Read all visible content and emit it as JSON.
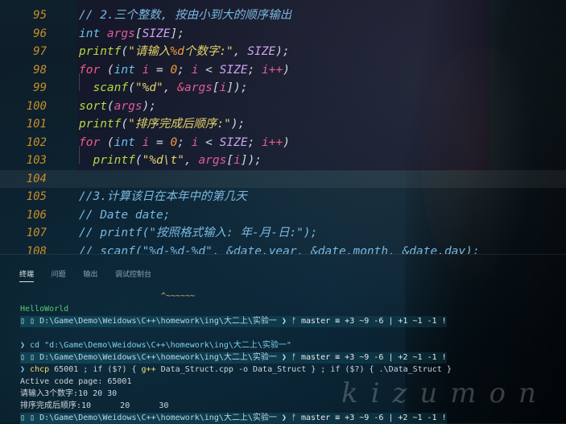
{
  "editor": {
    "lines": [
      {
        "n": "95",
        "tokens": [
          [
            "t-comment",
            "// 2.三个整数, 按由小到大的顺序输出"
          ]
        ]
      },
      {
        "n": "96",
        "tokens": [
          [
            "t-type",
            "int "
          ],
          [
            "t-var",
            "args"
          ],
          [
            "t-punc",
            "["
          ],
          [
            "t-const",
            "SIZE"
          ],
          [
            "t-punc",
            "];"
          ]
        ]
      },
      {
        "n": "97",
        "tokens": [
          [
            "t-fn",
            "printf"
          ],
          [
            "t-punc",
            "("
          ],
          [
            "t-str",
            "\"请输入"
          ],
          [
            "t-num",
            "%d"
          ],
          [
            "t-str",
            "个数字:\""
          ],
          [
            "t-punc",
            ", "
          ],
          [
            "t-const",
            "SIZE"
          ],
          [
            "t-punc",
            ");"
          ]
        ]
      },
      {
        "n": "98",
        "tokens": [
          [
            "t-kw",
            "for "
          ],
          [
            "t-punc",
            "("
          ],
          [
            "t-type",
            "int "
          ],
          [
            "t-var",
            "i"
          ],
          [
            "t-punc",
            " = "
          ],
          [
            "t-num",
            "0"
          ],
          [
            "t-punc",
            "; "
          ],
          [
            "t-var",
            "i"
          ],
          [
            "t-punc",
            " < "
          ],
          [
            "t-const",
            "SIZE"
          ],
          [
            "t-punc",
            "; "
          ],
          [
            "t-var",
            "i"
          ],
          [
            "t-kw",
            "++"
          ],
          [
            "t-punc",
            ")"
          ]
        ]
      },
      {
        "n": "99",
        "tokens": [
          [
            "t-ws",
            "  "
          ],
          [
            "t-fn",
            "scanf"
          ],
          [
            "t-punc",
            "("
          ],
          [
            "t-str",
            "\"%d\""
          ],
          [
            "t-punc",
            ", "
          ],
          [
            "t-kw",
            "&"
          ],
          [
            "t-var",
            "args"
          ],
          [
            "t-punc",
            "["
          ],
          [
            "t-var",
            "i"
          ],
          [
            "t-punc",
            "]);"
          ]
        ]
      },
      {
        "n": "100",
        "tokens": [
          [
            "t-fn",
            "sort"
          ],
          [
            "t-punc",
            "("
          ],
          [
            "t-var",
            "args"
          ],
          [
            "t-punc",
            ");"
          ]
        ]
      },
      {
        "n": "101",
        "tokens": [
          [
            "t-fn",
            "printf"
          ],
          [
            "t-punc",
            "("
          ],
          [
            "t-str",
            "\"排序完成后顺序:\""
          ],
          [
            "t-punc",
            ");"
          ]
        ]
      },
      {
        "n": "102",
        "tokens": [
          [
            "t-kw",
            "for "
          ],
          [
            "t-punc",
            "("
          ],
          [
            "t-type",
            "int "
          ],
          [
            "t-var",
            "i"
          ],
          [
            "t-punc",
            " = "
          ],
          [
            "t-num",
            "0"
          ],
          [
            "t-punc",
            "; "
          ],
          [
            "t-var",
            "i"
          ],
          [
            "t-punc",
            " < "
          ],
          [
            "t-const",
            "SIZE"
          ],
          [
            "t-punc",
            "; "
          ],
          [
            "t-var",
            "i"
          ],
          [
            "t-kw",
            "++"
          ],
          [
            "t-punc",
            ")"
          ]
        ]
      },
      {
        "n": "103",
        "tokens": [
          [
            "t-ws",
            "  "
          ],
          [
            "t-fn",
            "printf"
          ],
          [
            "t-punc",
            "("
          ],
          [
            "t-str",
            "\"%d\\t\""
          ],
          [
            "t-punc",
            ", "
          ],
          [
            "t-var",
            "args"
          ],
          [
            "t-punc",
            "["
          ],
          [
            "t-var",
            "i"
          ],
          [
            "t-punc",
            "]);"
          ]
        ]
      },
      {
        "n": "104",
        "tokens": []
      },
      {
        "n": "105",
        "tokens": [
          [
            "t-comment",
            "//3.计算该日在本年中的第几天"
          ]
        ]
      },
      {
        "n": "106",
        "tokens": [
          [
            "t-comment",
            "// Date date;"
          ]
        ]
      },
      {
        "n": "107",
        "tokens": [
          [
            "t-comment",
            "// printf(\"按照格式输入: 年-月-日:\");"
          ]
        ]
      },
      {
        "n": "108",
        "tokens": [
          [
            "t-comment",
            "// scanf(\"%d-%d-%d\", &date.year, &date.month, &date.day);"
          ]
        ]
      }
    ]
  },
  "panel": {
    "tabs": [
      "终端",
      "问题",
      "输出",
      "调试控制台"
    ],
    "squiggle": "^~~~~~~",
    "hello": "HelloWorld",
    "prompt_dir": "D:\\Game\\Demo\\Weidows\\C++\\homework\\ing\\大二上\\实验一",
    "prompt1_git": "ᚠ master ≡ +3 ~9 -6 | +1 ~1 -1 !",
    "cd_cmd": "❯ cd \"d:\\Game\\Demo\\Weidows\\C++\\homework\\ing\\大二上\\实验一\"",
    "prompt2_git": "ᚠ master ≡ +3 ~9 -6 | +2 ~1 -1 !",
    "chcp_prefix": "❯ ",
    "chcp_cmd": "chcp",
    "chcp_rest": " 65001 ; if ($?) { ",
    "gpp": "g++",
    "gpp_rest": " Data_Struct.cpp -o Data_Struct } ; if ($?) { .\\Data_Struct }",
    "out1": "Active code page: 65001",
    "out2": "请输入3个数字:10 20 30",
    "out3": "排序完成后顺序:10      20      30",
    "prompt3_git": "ᚠ master ≡ +3 ~9 -6 | +2 ~1 -1 !",
    "watermark": "kizumon"
  }
}
